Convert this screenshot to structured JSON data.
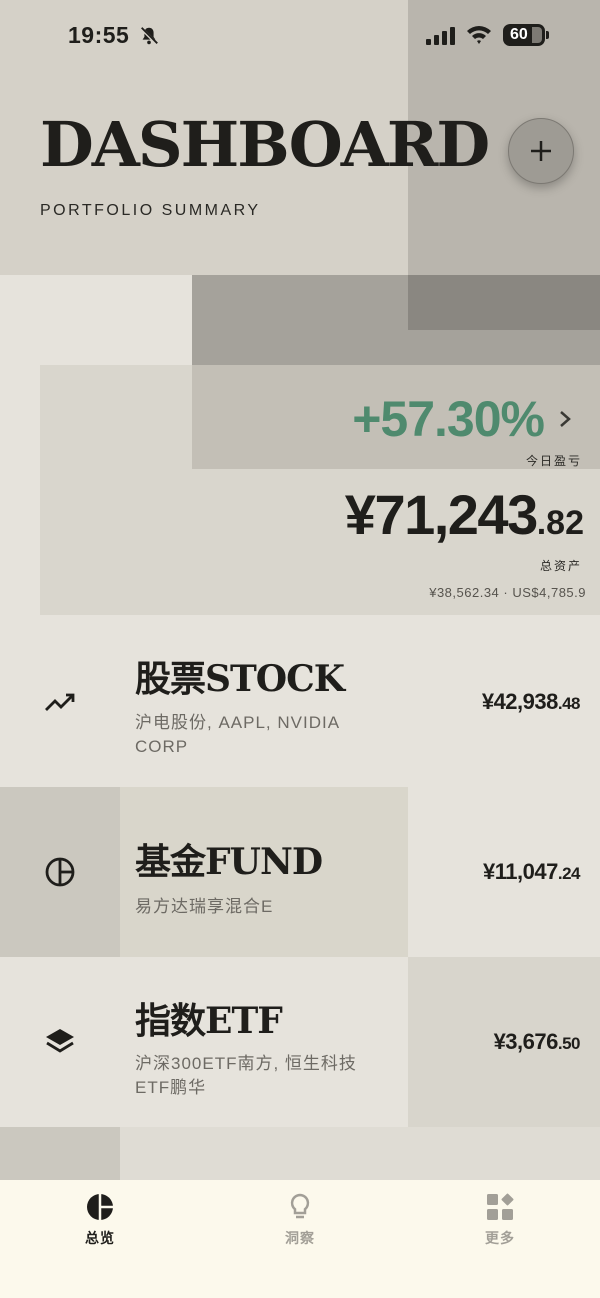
{
  "status_bar": {
    "time": "19:55",
    "battery": "60",
    "icons": [
      "bell-slash-icon",
      "signal-icon",
      "wifi-icon",
      "battery-icon"
    ]
  },
  "header": {
    "title": "DASHBOARD",
    "subtitle": "PORTFOLIO SUMMARY",
    "add_icon": "plus-icon"
  },
  "summary": {
    "change_percent": "+57.30%",
    "change_label": "今日盈亏",
    "total_int": "¥71,243",
    "total_dec": ".82",
    "total_label": "总资产",
    "sub_values": "¥38,562.34 · US$4,785.9",
    "colors": {
      "positive": "#4f8a6e"
    }
  },
  "categories": [
    {
      "icon": "trend-up-icon",
      "title": "股票STOCK",
      "desc": "沪电股份, AAPL, NVIDIA CORP",
      "value_int": "¥42,938",
      "value_dec": ".48"
    },
    {
      "icon": "pie-chart-icon",
      "title": "基金FUND",
      "desc": "易方达瑞享混合E",
      "value_int": "¥11,047",
      "value_dec": ".24"
    },
    {
      "icon": "layers-icon",
      "title": "指数ETF",
      "desc": "沪深300ETF南方, 恒生科技ETF鹏华",
      "value_int": "¥3,676",
      "value_dec": ".50"
    }
  ],
  "tabs": [
    {
      "label": "总览",
      "icon": "pie-chart-icon",
      "active": true
    },
    {
      "label": "洞察",
      "icon": "lightbulb-icon",
      "active": false
    },
    {
      "label": "更多",
      "icon": "grid-icon",
      "active": false
    }
  ]
}
